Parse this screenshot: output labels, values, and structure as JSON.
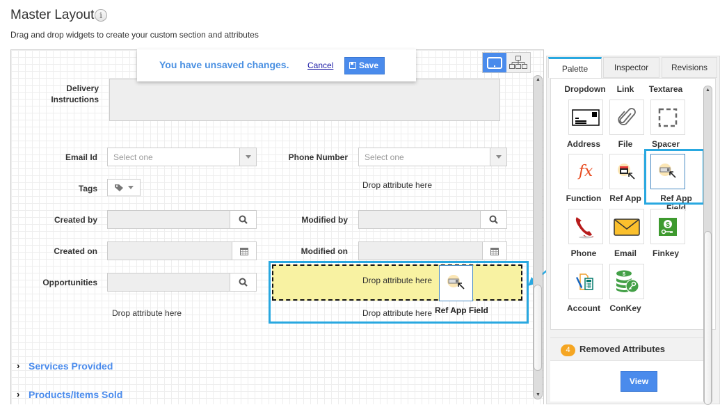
{
  "header": {
    "title": "Master Layout",
    "info_icon": "i",
    "subtitle": "Drag and drop widgets to create your custom section and attributes"
  },
  "unsaved": {
    "message": "You have unsaved changes.",
    "cancel_label": "Cancel",
    "save_label": "Save"
  },
  "view_toggle": {
    "active": "tablet-view",
    "options": [
      "tablet-view",
      "hierarchy-view"
    ]
  },
  "form": {
    "delivery_label_1": "Delivery",
    "delivery_label_2": "Instructions",
    "email_label": "Email Id",
    "email_placeholder": "Select one",
    "phone_label": "Phone Number",
    "phone_placeholder": "Select one",
    "tags_label": "Tags",
    "created_by_label": "Created by",
    "modified_by_label": "Modified by",
    "created_on_label": "Created on",
    "modified_on_label": "Modified on",
    "opportunities_label": "Opportunities",
    "drop_text": "Drop attribute here"
  },
  "drag": {
    "ghost_label": "Ref App Field"
  },
  "sections": [
    {
      "label": "Services Provided"
    },
    {
      "label": "Products/Items Sold"
    }
  ],
  "panel": {
    "tabs": [
      "Palette",
      "Inspector",
      "Revisions"
    ],
    "active_tab": "Palette",
    "widgets": [
      {
        "label": "Dropdown",
        "icon": ""
      },
      {
        "label": "Link",
        "icon": ""
      },
      {
        "label": "Textarea",
        "icon": ""
      },
      {
        "label": "Address",
        "icon": "address-card-icon"
      },
      {
        "label": "File",
        "icon": "paperclip-icon"
      },
      {
        "label": "Spacer",
        "icon": "spacer-icon"
      },
      {
        "label": "Function",
        "icon": "function-icon"
      },
      {
        "label": "Ref App",
        "icon": "ref-app-icon"
      },
      {
        "label": "Ref App Field",
        "icon": "ref-app-field-icon"
      },
      {
        "label": "Phone",
        "icon": "phone-icon"
      },
      {
        "label": "Email",
        "icon": "envelope-icon"
      },
      {
        "label": "Finkey",
        "icon": "finkey-icon"
      },
      {
        "label": "Account",
        "icon": "account-icon"
      },
      {
        "label": "ConKey",
        "icon": "conkey-icon"
      }
    ],
    "function_glyph": "fx",
    "removed": {
      "count": "4",
      "title": "Removed Attributes",
      "view_label": "View"
    }
  },
  "colors": {
    "accent": "#4a8bec",
    "highlight": "#29a8e0",
    "drop_zone": "#f8f2a2",
    "badge": "#f5a623"
  }
}
